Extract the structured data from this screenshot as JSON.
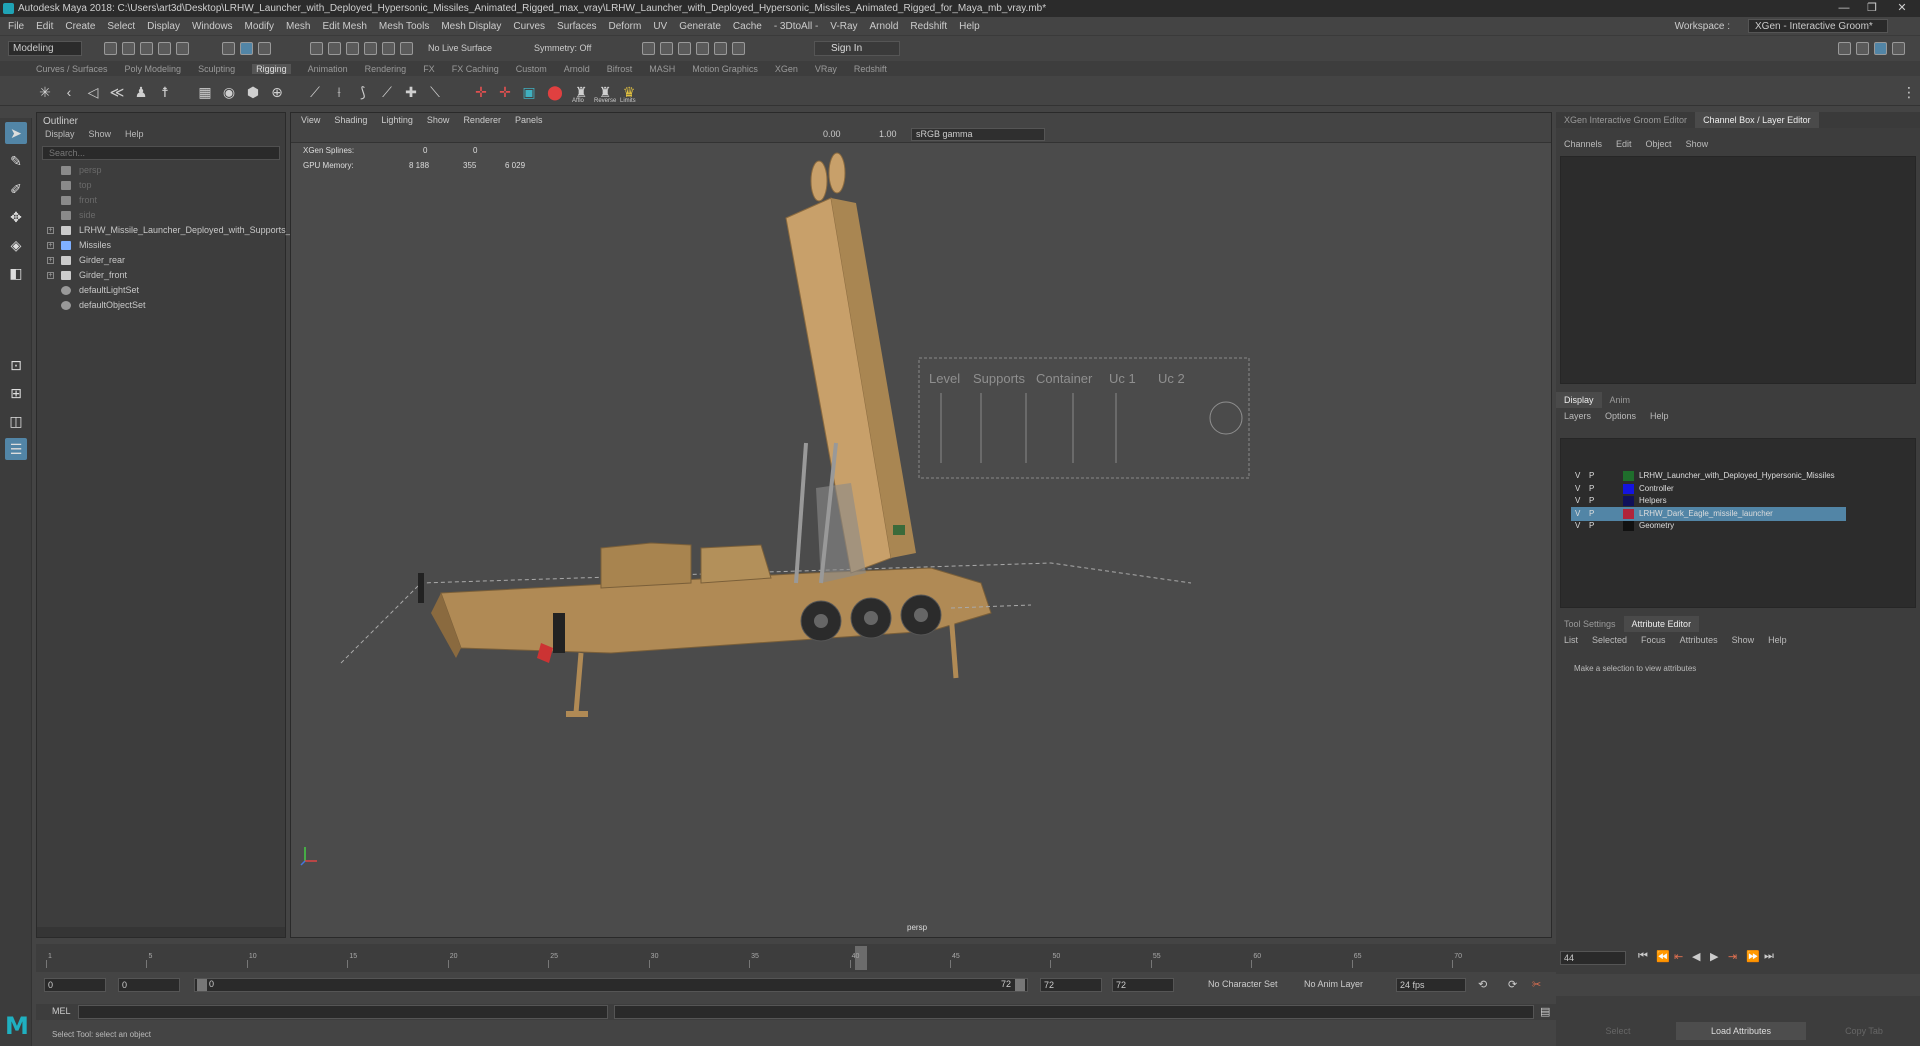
{
  "title_bar": {
    "title": "Autodesk Maya 2018: C:\\Users\\art3d\\Desktop\\LRHW_Launcher_with_Deployed_Hypersonic_Missiles_Animated_Rigged_max_vray\\LRHW_Launcher_with_Deployed_Hypersonic_Missiles_Animated_Rigged_for_Maya_mb_vray.mb*",
    "minimize": "—",
    "maximize": "❐",
    "close": "✕"
  },
  "menu": {
    "items": [
      "File",
      "Edit",
      "Create",
      "Select",
      "Display",
      "Windows",
      "Modify",
      "Mesh",
      "Edit Mesh",
      "Mesh Tools",
      "Mesh Display",
      "Curves",
      "Surfaces",
      "Deform",
      "UV",
      "Generate",
      "Cache",
      "- 3DtoAll -",
      "V-Ray",
      "Arnold",
      "Redshift",
      "Help"
    ],
    "workspace_label": "Workspace :",
    "workspace_value": "XGen - Interactive Groom*"
  },
  "status_line": {
    "mode": "Modeling",
    "live_surface": "No Live Surface",
    "symmetry": "Symmetry: Off",
    "sign_in": "Sign In"
  },
  "shelf": {
    "tabs": [
      "Curves / Surfaces",
      "Poly Modeling",
      "Sculpting",
      "Rigging",
      "Animation",
      "Rendering",
      "FX",
      "FX Caching",
      "Custom",
      "Arnold",
      "Bifrost",
      "MASH",
      "Motion Graphics",
      "XGen",
      "VRay",
      "Redshift"
    ],
    "active_tab": "Rigging",
    "icon_labels": [
      "Afflo",
      "Reverse",
      "Limits"
    ]
  },
  "outliner": {
    "title": "Outliner",
    "menu": [
      "Display",
      "Show",
      "Help"
    ],
    "search_placeholder": "Search...",
    "items": [
      {
        "label": "persp",
        "dim": true,
        "type": "camera"
      },
      {
        "label": "top",
        "dim": true,
        "type": "camera"
      },
      {
        "label": "front",
        "dim": true,
        "type": "camera"
      },
      {
        "label": "side",
        "dim": true,
        "type": "camera"
      },
      {
        "label": "LRHW_Missile_Launcher_Deployed_with_Supports_A",
        "dim": false,
        "type": "group",
        "expandable": true
      },
      {
        "label": "Missiles",
        "dim": false,
        "type": "joint",
        "expandable": true
      },
      {
        "label": "Girder_rear",
        "dim": false,
        "type": "group",
        "expandable": true
      },
      {
        "label": "Girder_front",
        "dim": false,
        "type": "group",
        "expandable": true
      },
      {
        "label": "defaultLightSet",
        "dim": false,
        "type": "set"
      },
      {
        "label": "defaultObjectSet",
        "dim": false,
        "type": "set"
      }
    ]
  },
  "viewport": {
    "menu": [
      "View",
      "Shading",
      "Lighting",
      "Show",
      "Renderer",
      "Panels"
    ],
    "exposure": "0.00",
    "gamma": "1.00",
    "color_space": "sRGB gamma",
    "hud": {
      "xgen_splines_label": "XGen Splines:",
      "xgen_splines_a": "0",
      "xgen_splines_b": "0",
      "gpu_memory_label": "GPU Memory:",
      "gpu_memory_a": "8 188",
      "gpu_memory_b": "355",
      "gpu_memory_c": "6 029"
    },
    "camera": "persp",
    "scene_text": {
      "level": "Level",
      "supports": "Supports",
      "container": "Container",
      "uc1": "Uc 1",
      "uc2": "Uc 2"
    }
  },
  "right_panel": {
    "top_tabs": [
      "XGen Interactive Groom Editor",
      "Channel Box / Layer Editor"
    ],
    "active_top_tab": "Channel Box / Layer Editor",
    "channel_menu": [
      "Channels",
      "Edit",
      "Object",
      "Show"
    ],
    "layer_tabs": [
      "Display",
      "Anim"
    ],
    "layer_menu": [
      "Layers",
      "Options",
      "Help"
    ],
    "layers": [
      {
        "v": "V",
        "p": "P",
        "color": "#1f6e2c",
        "name": "LRHW_Launcher_with_Deployed_Hypersonic_Missiles",
        "selected": false
      },
      {
        "v": "V",
        "p": "P",
        "color": "#1414e0",
        "name": "Controller",
        "selected": false
      },
      {
        "v": "V",
        "p": "P",
        "color": "#10105a",
        "name": "Helpers",
        "selected": false
      },
      {
        "v": "V",
        "p": "P",
        "color": "#b0243a",
        "name": "LRHW_Dark_Eagle_missile_launcher",
        "selected": true
      },
      {
        "v": "V",
        "p": "P",
        "color": "#111111",
        "name": "Geometry",
        "selected": false
      }
    ],
    "attr_tabs": [
      "Tool Settings",
      "Attribute Editor"
    ],
    "active_attr_tab": "Attribute Editor",
    "attr_menu": [
      "List",
      "Selected",
      "Focus",
      "Attributes",
      "Show",
      "Help"
    ],
    "attr_message": "Make a selection to view attributes",
    "buttons": [
      "Select",
      "Load Attributes",
      "Copy Tab"
    ]
  },
  "timeline": {
    "ticks": [
      "1",
      "5",
      "10",
      "15",
      "20",
      "25",
      "30",
      "35",
      "40",
      "45",
      "50",
      "55",
      "60",
      "65",
      "70"
    ],
    "current_frame": "44",
    "playhead_fraction": 0.6
  },
  "range": {
    "start": "0",
    "start_inner": "0",
    "slider_start": "0",
    "slider_end": "72",
    "end_inner": "72",
    "end": "72",
    "character_set": "No Character Set",
    "anim_layer": "No Anim Layer",
    "fps": "24 fps"
  },
  "command_line": {
    "label": "MEL",
    "help": "Select Tool: select an object"
  },
  "colors": {
    "accent": "#5285a6",
    "launcher": "#b8915a",
    "maya_logo": "#1fb0c0"
  }
}
